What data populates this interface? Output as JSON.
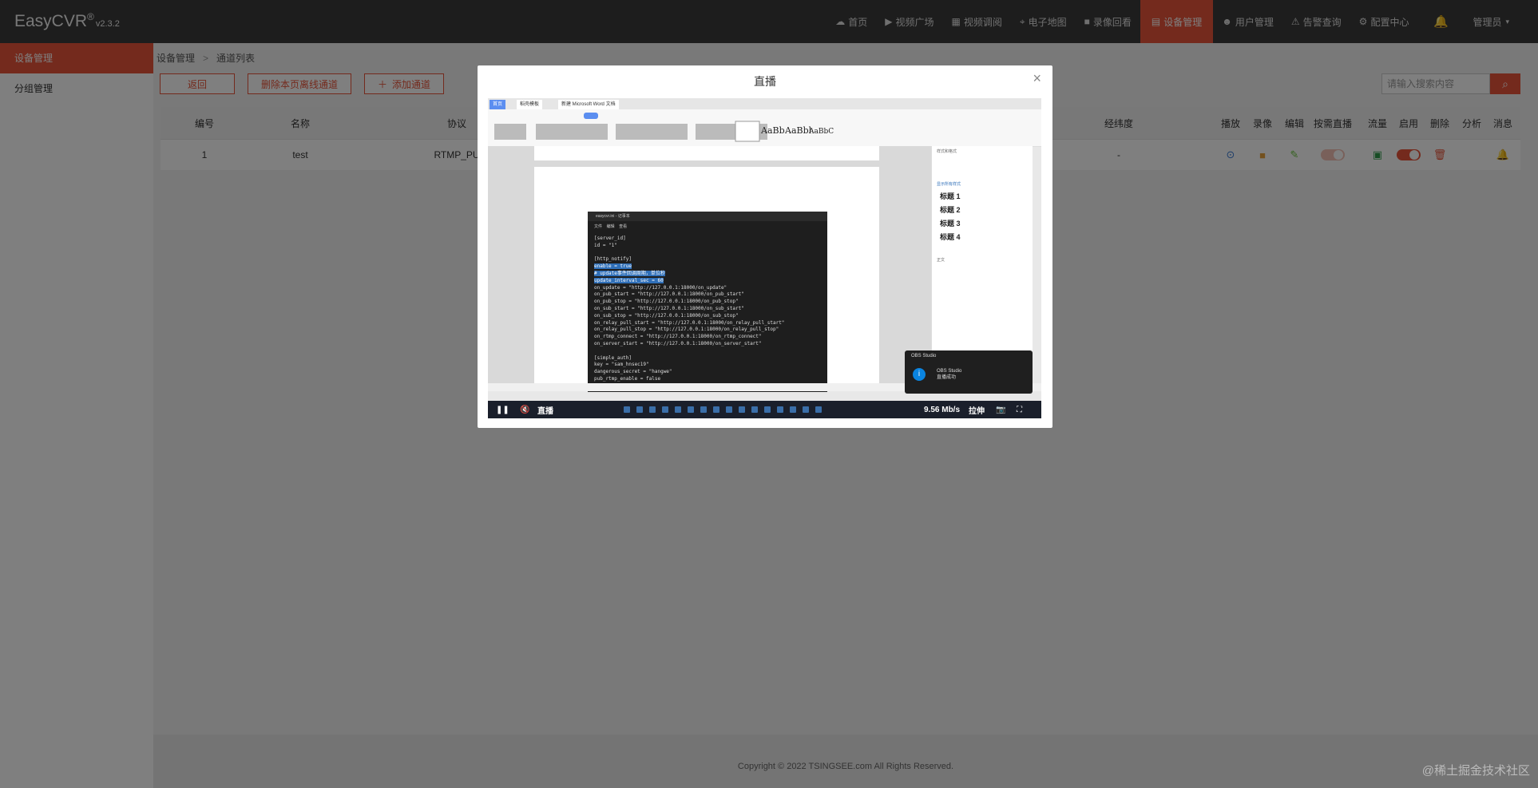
{
  "app": {
    "brand": "EasyCVR",
    "reg": "®",
    "version": "v2.3.2"
  },
  "nav": {
    "items": [
      {
        "label": "首页",
        "icon": "☁"
      },
      {
        "label": "视频广场",
        "icon": "▶"
      },
      {
        "label": "视频调阅",
        "icon": "▦"
      },
      {
        "label": "电子地图",
        "icon": "⌖"
      },
      {
        "label": "录像回看",
        "icon": "■"
      }
    ],
    "active": {
      "label": "设备管理",
      "icon": "▤"
    },
    "items2": [
      {
        "label": "用户管理",
        "icon": "☻"
      },
      {
        "label": "告警查询",
        "icon": "⚠"
      },
      {
        "label": "配置中心",
        "icon": "⚙"
      }
    ],
    "user": "管理员"
  },
  "sidebar": {
    "items": [
      {
        "label": "设备管理"
      },
      {
        "label": "分组管理"
      }
    ]
  },
  "breadcrumb": {
    "root": "设备管理",
    "sep": ">",
    "current": "通道列表"
  },
  "toolbar": {
    "back": "返回",
    "delete_offline": "删除本页离线通道",
    "add": "添加通道"
  },
  "search": {
    "placeholder": "请输入搜索内容"
  },
  "table": {
    "headers": {
      "no": "编号",
      "name": "名称",
      "protocol": "协议",
      "lat": "经纬度",
      "play": "播放",
      "record": "录像",
      "edit": "编辑",
      "demand": "按需直播",
      "stream": "流量",
      "enable": "启用",
      "delete": "删除",
      "analyze": "分析",
      "message": "消息"
    },
    "row": {
      "no": "1",
      "name": "test",
      "protocol": "RTMP_PU",
      "lat": "-"
    }
  },
  "footer": {
    "copyright": "Copyright © 2022 TSINGSEE.com All Rights Reserved."
  },
  "watermark": "@稀土掘金技术社区",
  "modal": {
    "title": "直播",
    "close": "×",
    "player": {
      "live_label": "直播",
      "bitrate": "9.56 Mb/s",
      "stretch": "拉伸"
    },
    "inner": {
      "tab1": "首页",
      "tab2": "稻壳模板",
      "tab3": "新建 Microsoft Word 文档",
      "menu": [
        "文件",
        "编辑",
        "查看"
      ],
      "style_headings": [
        "标题 1",
        "标题 2",
        "标题 3",
        "标题 4"
      ],
      "side_header": "样式和格式",
      "side_options": "显示所有样式",
      "side_body": "正文",
      "terminal_title": "easycvr.ini - 记事本",
      "code": [
        "[server_id]",
        "id = \"1\"",
        "",
        "[http_notify]",
        "enable = true",
        "# update事件回调周期，单位秒",
        "update_interval_sec = 60",
        "on_update = \"http://127.0.0.1:18000/on_update\"",
        "on_pub_start = \"http://127.0.0.1:18000/on_pub_start\"",
        "on_pub_stop = \"http://127.0.0.1:18000/on_pub_stop\"",
        "on_sub_start = \"http://127.0.0.1:18000/on_sub_start\"",
        "on_sub_stop = \"http://127.0.0.1:18000/on_sub_stop\"",
        "on_relay_pull_start = \"http://127.0.0.1:18000/on_relay_pull_start\"",
        "on_relay_pull_stop = \"http://127.0.0.1:18000/on_relay_pull_stop\"",
        "on_rtmp_connect = \"http://127.0.0.1:18000/on_rtmp_connect\"",
        "on_server_start = \"http://127.0.0.1:18000/on_server_start\"",
        "",
        "[simple_auth]",
        "key = \"sam_hnsec19\"",
        "dangerous_secret = \"hangwe\"",
        "pub_rtmp_enable = false"
      ],
      "toast_title": "OBS Studio",
      "toast_msg1": "OBS Studio",
      "toast_msg2": "直播成功"
    }
  },
  "colors": {
    "accent": "#e8553a",
    "topbar": "#3a3a3a",
    "play": "#3a7bd5",
    "record": "#e6a23c",
    "edit": "#67c23a",
    "bell": "#f5a623"
  }
}
